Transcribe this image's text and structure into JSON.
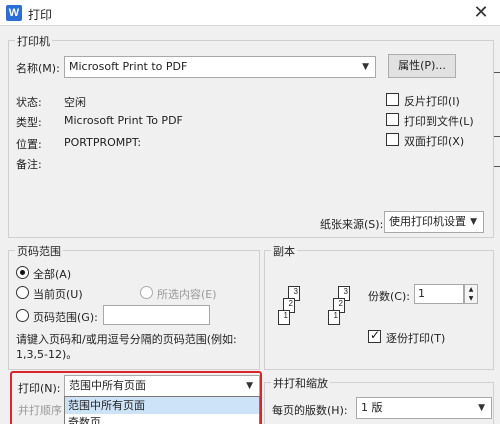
{
  "window": {
    "title": "打印",
    "app_icon_letter": "W",
    "close_glyph": "✕"
  },
  "printer": {
    "group_label": "打印机",
    "name_label": "名称(M):",
    "name_value": "Microsoft Print to PDF",
    "properties_button": "属性(P)...",
    "status_label": "状态:",
    "status_value": "空闲",
    "type_label": "类型:",
    "type_value": "Microsoft Print To PDF",
    "location_label": "位置:",
    "location_value": "PORTPROMPT:",
    "comment_label": "备注:",
    "reverse_print": "反片打印(I)",
    "print_to_file": "打印到文件(L)",
    "duplex_print": "双面打印(X)",
    "paper_source_label": "纸张来源(S):",
    "paper_source_value": "使用打印机设置"
  },
  "page_range": {
    "group_label": "页码范围",
    "all": "全部(A)",
    "current": "当前页(U)",
    "selection": "所选内容(E)",
    "range": "页码范围(G):",
    "range_value": "",
    "hint": "请键入页码和/或用逗号分隔的页码范围(例如:\n1,3,5-12)。"
  },
  "copies": {
    "group_label": "副本",
    "count_label": "份数(C):",
    "count_value": "1",
    "collate": "逐份打印(T)"
  },
  "print_what": {
    "label": "打印(N):",
    "value": "范围中所有页面",
    "order_label": "并打顺序",
    "options": [
      "范围中所有页面",
      "奇数页"
    ]
  },
  "zoom": {
    "group_label": "并打和缩放",
    "pages_per_sheet_label": "每页的版数(H):",
    "pages_per_sheet_value": "1 版"
  }
}
